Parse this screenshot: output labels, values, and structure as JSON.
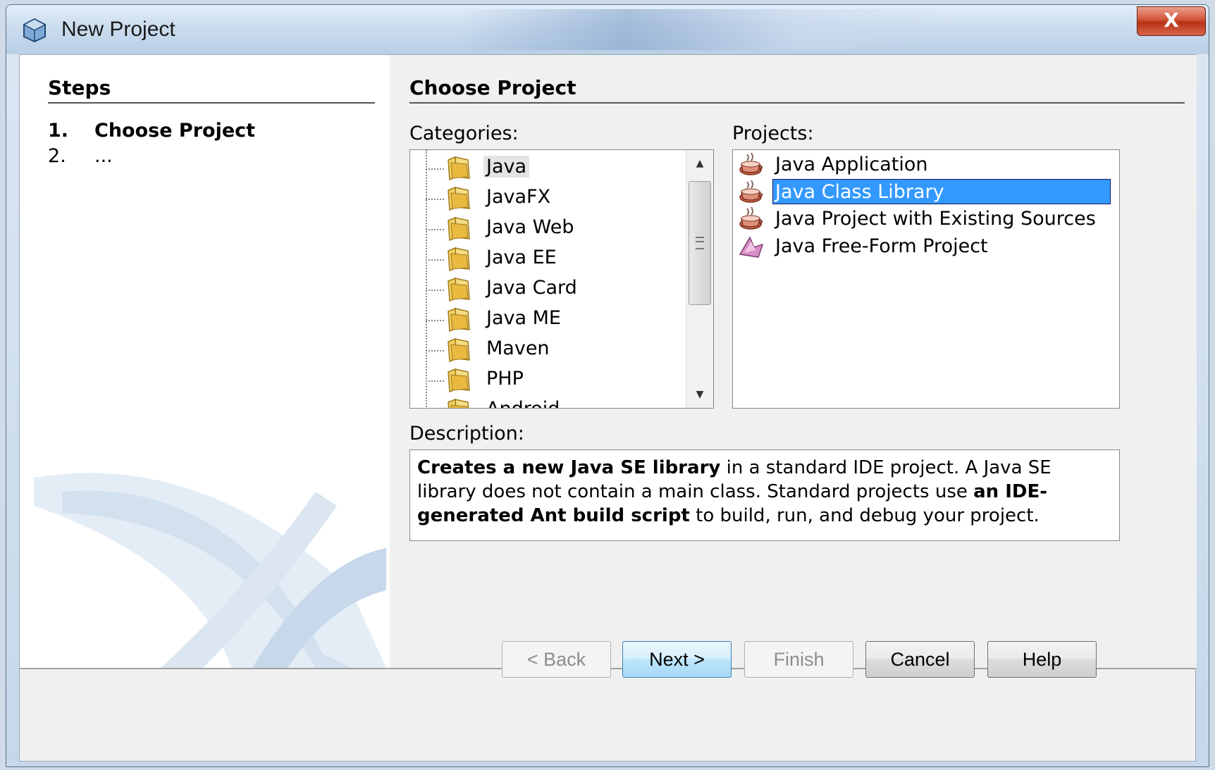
{
  "window": {
    "title": "New Project",
    "close_glyph": "X"
  },
  "steps": {
    "header": "Steps",
    "items": [
      {
        "num": "1.",
        "label": "Choose Project"
      },
      {
        "num": "2.",
        "label": "..."
      }
    ]
  },
  "main": {
    "header": "Choose Project",
    "categories_label": "Categories:",
    "projects_label": "Projects:",
    "description_label": "Description:",
    "categories": [
      "Java",
      "JavaFX",
      "Java Web",
      "Java EE",
      "Java Card",
      "Java ME",
      "Maven",
      "PHP",
      "Android"
    ],
    "selected_category": "Java",
    "projects": [
      {
        "label": "Java Application",
        "icon": "java-cup-icon"
      },
      {
        "label": "Java Class Library",
        "icon": "java-cup-icon"
      },
      {
        "label": "Java Project with Existing Sources",
        "icon": "java-cup-icon"
      },
      {
        "label": "Java Free-Form Project",
        "icon": "freeform-project-icon"
      }
    ],
    "selected_project": "Java Class Library",
    "description": {
      "part1_bold": "Creates a new Java SE library",
      "part2": " in a standard IDE project. A Java SE library does not contain a main class. Standard projects use ",
      "part3_bold": "an IDE-generated Ant build script",
      "part4": " to build, run, and debug your project."
    }
  },
  "buttons": {
    "back": "< Back",
    "next": "Next >",
    "finish": "Finish",
    "cancel": "Cancel",
    "help": "Help"
  },
  "colors": {
    "selection": "#3399ff",
    "close_button": "#c8452a"
  }
}
